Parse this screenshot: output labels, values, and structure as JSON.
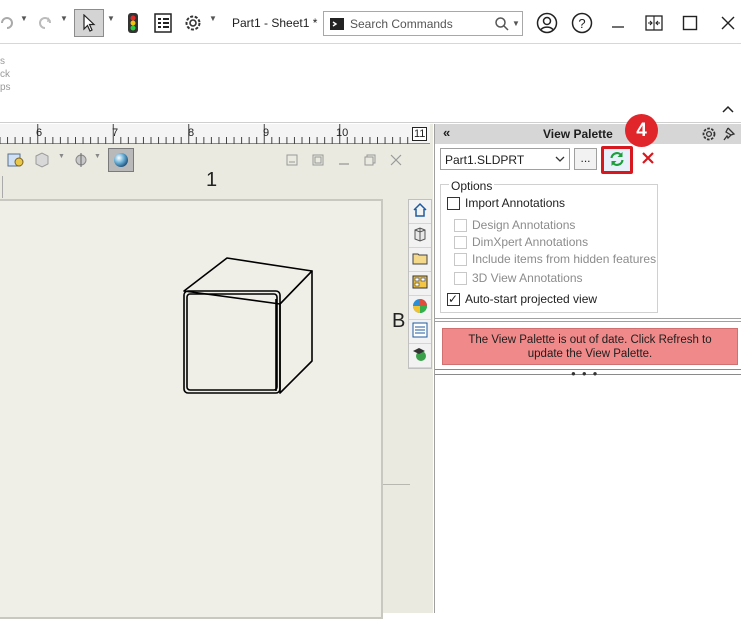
{
  "titlebar": {
    "document_title": "Part1 - Sheet1 *",
    "search_placeholder": "Search Commands"
  },
  "ribbon": {
    "fragments": [
      "s",
      "ck",
      "ps"
    ]
  },
  "ruler": {
    "ticks": [
      "6",
      "7",
      "8",
      "9",
      "10",
      "11"
    ]
  },
  "drawing": {
    "zone_top": "1",
    "zone_side": "B"
  },
  "view_palette": {
    "title": "View Palette",
    "file": "Part1.SLDPRT",
    "browse_label": "...",
    "step_number": "4",
    "options_label": "Options",
    "options": [
      {
        "label": "Import Annotations",
        "checked": false,
        "enabled": true
      },
      {
        "label": "Design Annotations",
        "checked": false,
        "enabled": false
      },
      {
        "label": "DimXpert Annotations",
        "checked": false,
        "enabled": false
      },
      {
        "label": "Include items from hidden features",
        "checked": false,
        "enabled": false
      },
      {
        "label": "3D View Annotations",
        "checked": false,
        "enabled": false
      },
      {
        "label": "Auto-start projected view",
        "checked": true,
        "enabled": true
      }
    ],
    "warning_line1": "The View Palette is out of date. Click Refresh to",
    "warning_line2": "update the View Palette."
  },
  "colors": {
    "accent_red": "#d7191f",
    "warning_bg": "#f08a8a",
    "graphics_bg": "#ebeae1"
  }
}
